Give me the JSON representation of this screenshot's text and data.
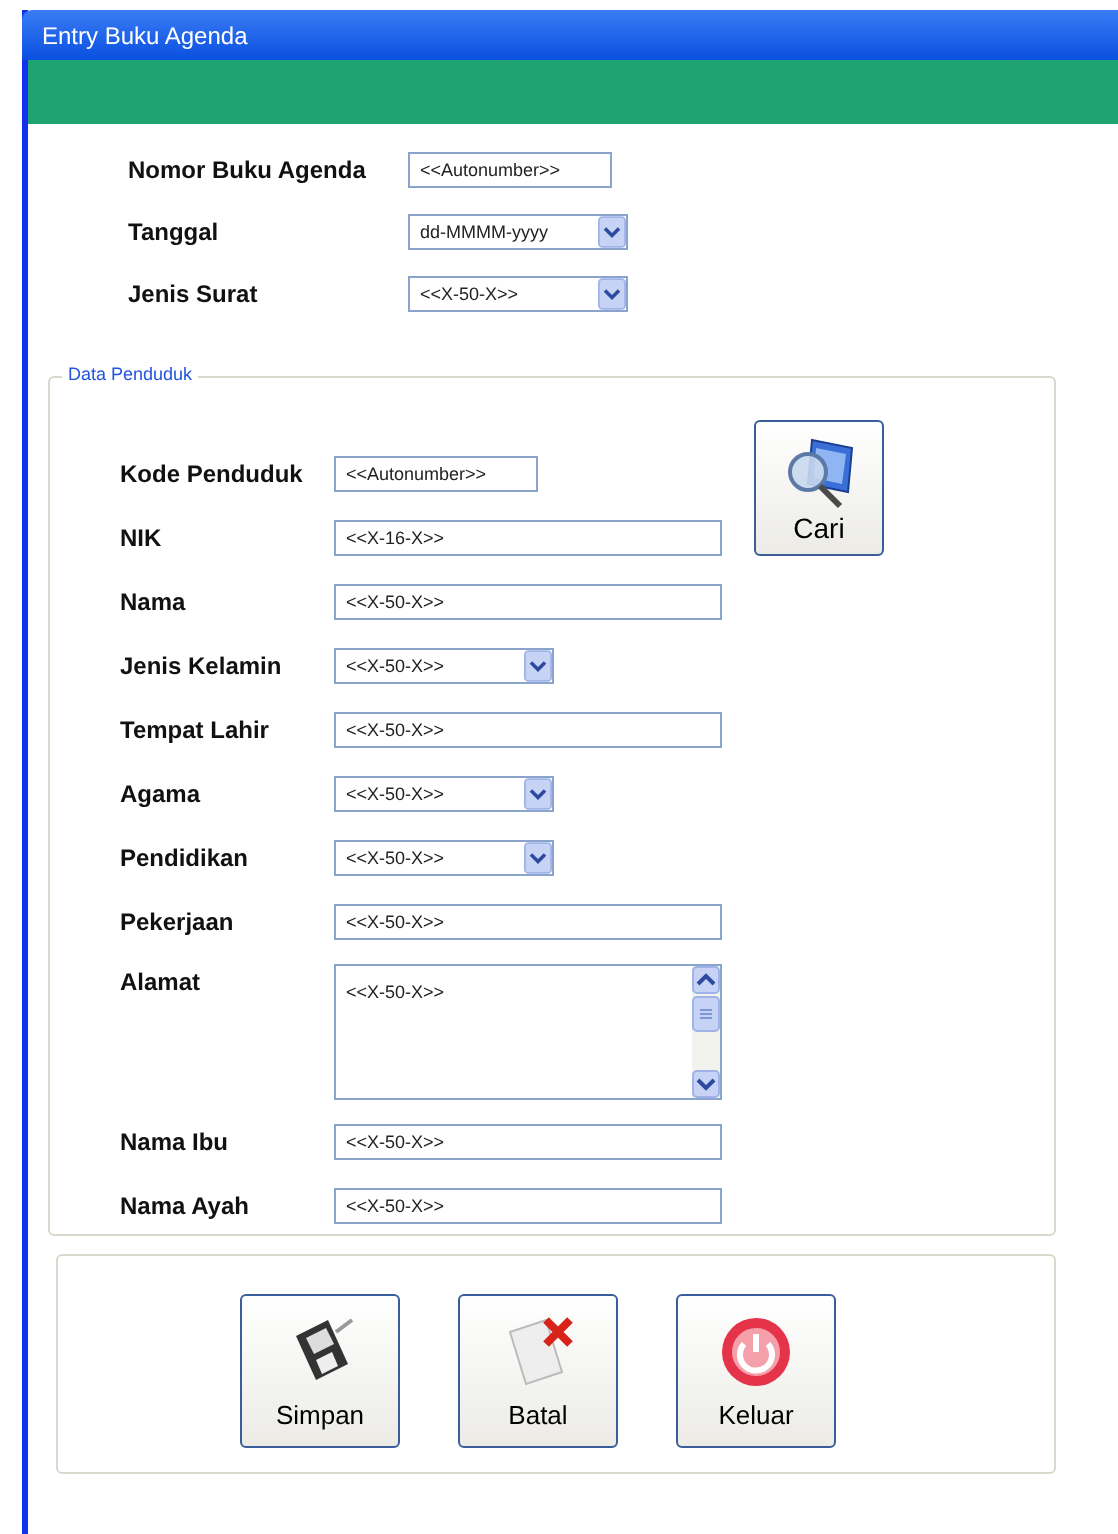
{
  "window": {
    "title": "Entry Buku Agenda"
  },
  "header_fields": [
    {
      "label": "Nomor Buku Agenda",
      "kind": "short",
      "value": "<<Autonumber>>"
    },
    {
      "label": "Tanggal",
      "kind": "select",
      "value": "dd-MMMM-yyyy"
    },
    {
      "label": "Jenis Surat",
      "kind": "select",
      "value": "<<X-50-X>>"
    }
  ],
  "section": {
    "legend": "Data Penduduk",
    "search_button": {
      "label": "Cari"
    },
    "fields": [
      {
        "label": "Kode Penduduk",
        "kind": "short",
        "value": "<<Autonumber>>"
      },
      {
        "label": "NIK",
        "kind": "text",
        "value": "<<X-16-X>>"
      },
      {
        "label": "Nama",
        "kind": "text",
        "value": "<<X-50-X>>"
      },
      {
        "label": "Jenis Kelamin",
        "kind": "select",
        "value": "<<X-50-X>>"
      },
      {
        "label": "Tempat Lahir",
        "kind": "text",
        "value": "<<X-50-X>>"
      },
      {
        "label": "Agama",
        "kind": "select",
        "value": "<<X-50-X>>"
      },
      {
        "label": "Pendidikan",
        "kind": "select",
        "value": "<<X-50-X>>"
      },
      {
        "label": "Pekerjaan",
        "kind": "text",
        "value": "<<X-50-X>>"
      },
      {
        "label": "Alamat",
        "kind": "textarea",
        "value": "<<X-50-X>>"
      },
      {
        "label": "Nama Ibu",
        "kind": "text",
        "value": "<<X-50-X>>"
      },
      {
        "label": "Nama Ayah",
        "kind": "text",
        "value": "<<X-50-X>>"
      }
    ]
  },
  "buttons": [
    {
      "label": "Simpan",
      "kind": "save"
    },
    {
      "label": "Batal",
      "kind": "cancel"
    },
    {
      "label": "Keluar",
      "kind": "exit"
    }
  ]
}
